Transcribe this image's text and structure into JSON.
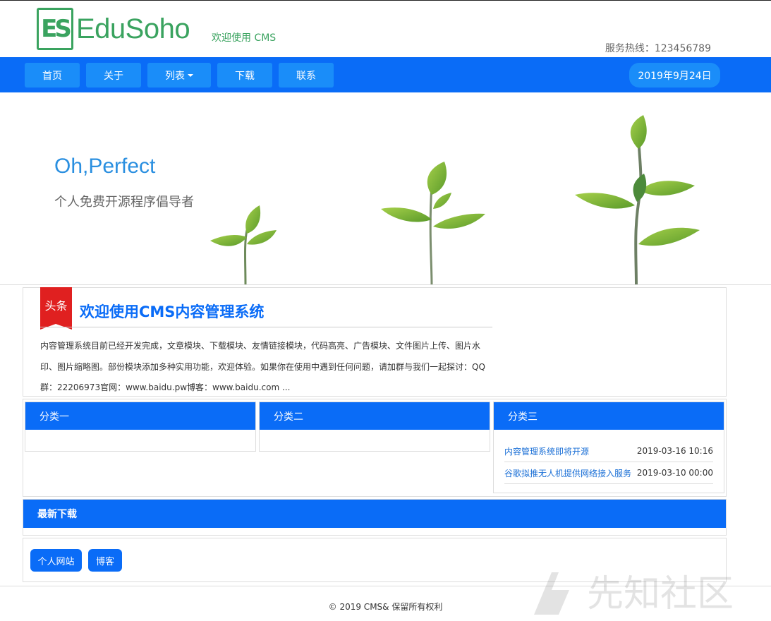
{
  "brand": {
    "logo_mark": "ES",
    "logo_text": "EduSoho",
    "slogan": "欢迎使用 CMS",
    "hotline": "服务热线：123456789"
  },
  "nav": {
    "items": [
      {
        "label": "首页"
      },
      {
        "label": "关于"
      },
      {
        "label": "列表"
      },
      {
        "label": "下载"
      },
      {
        "label": "联系"
      }
    ],
    "date": "2019年9月24日"
  },
  "banner": {
    "title": "Oh,Perfect",
    "subtitle": "个人免费开源程序倡导者"
  },
  "headline": {
    "tag": "头条",
    "title": "欢迎使用CMS内容管理系统",
    "body": "内容管理系统目前已经开发完成，文章模块、下载模块、友情链接模块，代码高亮、广告模块、文件图片上传、图片水印、图片缩略图。部份模块添加多种实用功能，欢迎体验。如果你在使用中遇到任何问题，请加群与我们一起探讨：QQ群：22206973官网：www.baidu.pw博客：www.baidu.com ..."
  },
  "categories": [
    {
      "title": "分类一",
      "items": []
    },
    {
      "title": "分类二",
      "items": []
    },
    {
      "title": "分类三",
      "items": [
        {
          "title": "内容管理系统即将开源",
          "time": "2019-03-16 10:16"
        },
        {
          "title": "谷歌拟推无人机提供网络接入服务",
          "time": "2019-03-10 00:00"
        }
      ]
    }
  ],
  "downloads": {
    "title": "最新下载"
  },
  "friend_links": [
    {
      "label": "个人网站"
    },
    {
      "label": "博客"
    }
  ],
  "footer": {
    "copyright": "© 2019 CMS& 保留所有权利"
  },
  "watermark": {
    "text": "先知社区"
  },
  "colors": {
    "primary": "#0a6cf7",
    "nav_button": "#1a8df9",
    "logo_green": "#3aa35f",
    "ribbon_red": "#e02020"
  }
}
